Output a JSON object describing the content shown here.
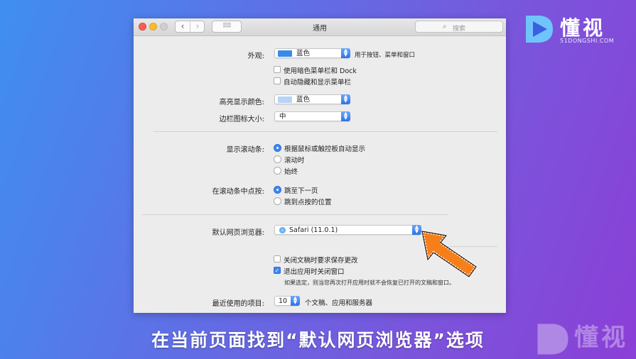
{
  "brand": {
    "name": "懂视",
    "domain": "51DONGSHI.COM"
  },
  "window": {
    "title": "通用",
    "search_placeholder": "搜索",
    "nav_back": "‹",
    "nav_forward": "›"
  },
  "settings": {
    "appearance": {
      "label": "外观:",
      "value": "蓝色",
      "hint": "用于按钮、菜单和窗口"
    },
    "dark_menu": {
      "label": "使用暗色菜单栏和 Dock",
      "checked": false
    },
    "auto_hide_menu": {
      "label": "自动隐藏和显示菜单栏",
      "checked": false
    },
    "highlight_color": {
      "label": "高亮显示颜色:",
      "value": "蓝色"
    },
    "sidebar_icon_size": {
      "label": "边栏图标大小:",
      "value": "中"
    },
    "show_scroll_bars": {
      "label": "显示滚动条:",
      "options": [
        "根据鼠标或触控板自动显示",
        "滚动时",
        "始终"
      ],
      "selected": 0
    },
    "click_scroll_bar": {
      "label": "在滚动条中点按:",
      "options": [
        "跳至下一页",
        "跳到点按的位置"
      ],
      "selected": 0
    },
    "default_browser": {
      "label": "默认网页浏览器:",
      "value": "Safari (11.0.1)"
    },
    "ask_keep_changes": {
      "label": "关闭文稿时要求保存更改",
      "checked": false
    },
    "close_windows_on_quit": {
      "label": "退出应用时关闭窗口",
      "checked": true
    },
    "close_windows_note": "如果选定，则当您再次打开应用时就不会恢复已打开的文稿和窗口。",
    "recent_items": {
      "label": "最近使用的项目:",
      "value": "10",
      "suffix": "个文稿、应用和服务器"
    }
  },
  "caption": "在当前页面找到“默认网页浏览器”选项",
  "colors": {
    "accent": "#3d85f2",
    "arrow": "#f77f1a",
    "swatch_blue": "#3a8ae8",
    "swatch_highlight": "#b7d3f5"
  }
}
